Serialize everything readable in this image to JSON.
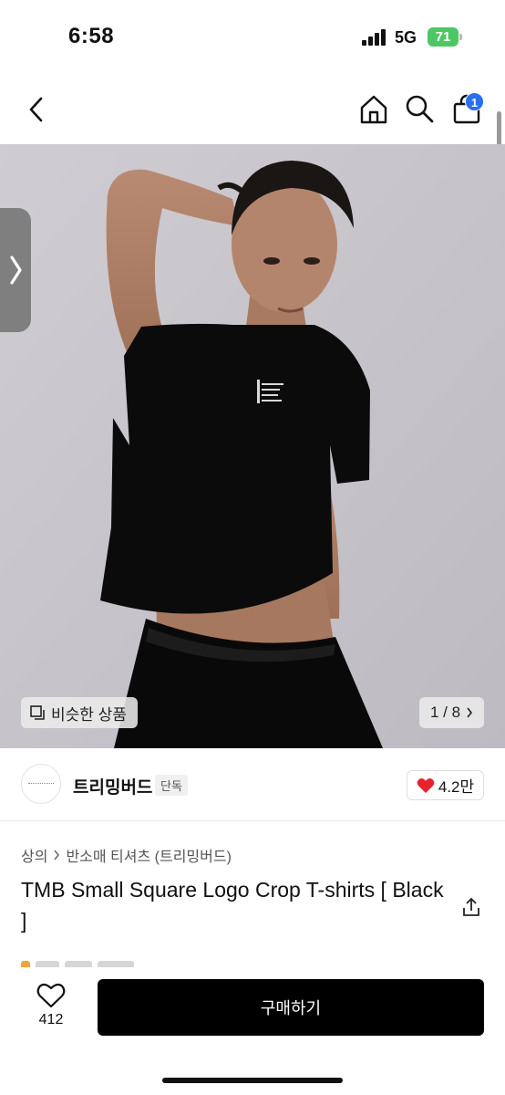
{
  "status_bar": {
    "time": "6:58",
    "network": "5G",
    "battery": "71"
  },
  "nav": {
    "icons": [
      "back-icon",
      "home-icon",
      "search-icon",
      "cart-icon"
    ],
    "cart_badge": "1"
  },
  "gallery": {
    "similar_button": "비슷한 상품",
    "page_current": "1",
    "page_total": "8",
    "page_label": "1 / 8"
  },
  "seller": {
    "name": "트리밍버드",
    "tag": "단독",
    "likes": "4.2만"
  },
  "product": {
    "breadcrumb": [
      "상의",
      "반소매 티셔츠 (트리밍버드)"
    ],
    "title": "TMB Small Square Logo Crop T-shirts [ Black ]"
  },
  "bottom_bar": {
    "wish_count": "412",
    "buy_label": "구매하기"
  },
  "colors": {
    "cart_badge": "#2a6ef0",
    "battery": "#4cc764",
    "like_heart": "#e8232f",
    "buy_button": "#000000"
  }
}
